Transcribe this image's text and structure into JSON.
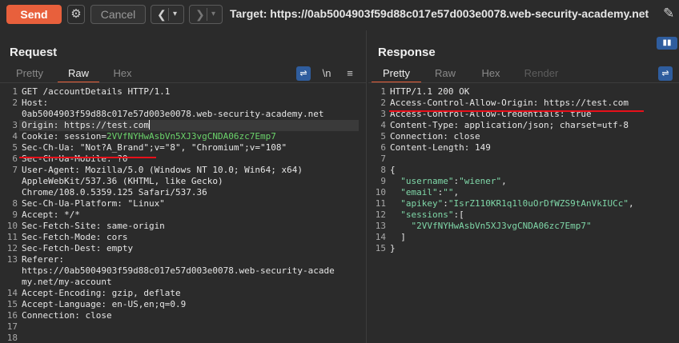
{
  "toolbar": {
    "send_label": "Send",
    "settings_icon": "gear-icon",
    "cancel_label": "Cancel",
    "back_icon": "chevron-left-icon",
    "forward_icon": "chevron-right-icon",
    "dropdown_icon": "caret-down-icon",
    "target_text": "Target: https://0ab5004903f59d88c017e57d003e0078.web-security-academy.net",
    "edit_icon": "pencil-icon"
  },
  "request": {
    "title": "Request",
    "tabs": [
      "Pretty",
      "Raw",
      "Hex"
    ],
    "active_tab": "Raw",
    "tools": {
      "wrap_icon": "wrap-lines-icon",
      "newline_label": "\\n",
      "menu_icon": "hamburger-icon"
    },
    "lines": [
      {
        "n": "1",
        "parts": [
          [
            "k",
            "GET /accountDetails HTTP/1.1"
          ]
        ]
      },
      {
        "n": "2",
        "parts": [
          [
            "k",
            "Host:"
          ]
        ]
      },
      {
        "n": "",
        "parts": [
          [
            "k",
            "0ab5004903f59d88c017e57d003e0078.web-security-academy.net"
          ]
        ]
      },
      {
        "n": "3",
        "parts": [
          [
            "k",
            "Origin: https://test.com"
          ]
        ],
        "highlight": true,
        "cursor": true
      },
      {
        "n": "4",
        "parts": [
          [
            "k",
            "Cookie: session="
          ],
          [
            "g",
            "2VVfNYHwAsbVn5XJ3vgCNDA06zc7Emp7"
          ]
        ]
      },
      {
        "n": "5",
        "parts": [
          [
            "k",
            "Sec-Ch-Ua: \"Not?A_Brand\";v=\"8\", \"Chromium\";v=\"108\""
          ]
        ]
      },
      {
        "n": "6",
        "parts": [
          [
            "k",
            "Sec-Ch-Ua-Mobile: ?0"
          ]
        ]
      },
      {
        "n": "7",
        "parts": [
          [
            "k",
            "User-Agent: Mozilla/5.0 (Windows NT 10.0; Win64; x64)"
          ]
        ]
      },
      {
        "n": "",
        "parts": [
          [
            "k",
            "AppleWebKit/537.36 (KHTML, like Gecko)"
          ]
        ]
      },
      {
        "n": "",
        "parts": [
          [
            "k",
            "Chrome/108.0.5359.125 Safari/537.36"
          ]
        ]
      },
      {
        "n": "8",
        "parts": [
          [
            "k",
            "Sec-Ch-Ua-Platform: \"Linux\""
          ]
        ]
      },
      {
        "n": "9",
        "parts": [
          [
            "k",
            "Accept: */*"
          ]
        ]
      },
      {
        "n": "10",
        "parts": [
          [
            "k",
            "Sec-Fetch-Site: same-origin"
          ]
        ]
      },
      {
        "n": "11",
        "parts": [
          [
            "k",
            "Sec-Fetch-Mode: cors"
          ]
        ]
      },
      {
        "n": "12",
        "parts": [
          [
            "k",
            "Sec-Fetch-Dest: empty"
          ]
        ]
      },
      {
        "n": "13",
        "parts": [
          [
            "k",
            "Referer:"
          ]
        ]
      },
      {
        "n": "",
        "parts": [
          [
            "k",
            "https://0ab5004903f59d88c017e57d003e0078.web-security-acade"
          ]
        ]
      },
      {
        "n": "",
        "parts": [
          [
            "k",
            "my.net/my-account"
          ]
        ]
      },
      {
        "n": "14",
        "parts": [
          [
            "k",
            "Accept-Encoding: gzip, deflate"
          ]
        ]
      },
      {
        "n": "15",
        "parts": [
          [
            "k",
            "Accept-Language: en-US,en;q=0.9"
          ]
        ]
      },
      {
        "n": "16",
        "parts": [
          [
            "k",
            "Connection: close"
          ]
        ]
      },
      {
        "n": "17",
        "parts": []
      },
      {
        "n": "18",
        "parts": []
      }
    ]
  },
  "response": {
    "title": "Response",
    "tabs": [
      "Pretty",
      "Raw",
      "Hex",
      "Render"
    ],
    "active_tab": "Pretty",
    "tools": {
      "wrap_icon": "wrap-lines-icon",
      "layout_icon": "split-layout-icon"
    },
    "lines": [
      {
        "n": "1",
        "parts": [
          [
            "k",
            "HTTP/1.1 200 OK"
          ]
        ]
      },
      {
        "n": "2",
        "parts": [
          [
            "k",
            "Access-Control-Allow-Origin: https://test.com"
          ]
        ]
      },
      {
        "n": "3",
        "parts": [
          [
            "k",
            "Access-Control-Allow-Credentials: true"
          ]
        ]
      },
      {
        "n": "4",
        "parts": [
          [
            "k",
            "Content-Type: application/json; charset=utf-8"
          ]
        ]
      },
      {
        "n": "5",
        "parts": [
          [
            "k",
            "Connection: close"
          ]
        ]
      },
      {
        "n": "6",
        "parts": [
          [
            "k",
            "Content-Length: 149"
          ]
        ]
      },
      {
        "n": "7",
        "parts": []
      },
      {
        "n": "8",
        "parts": [
          [
            "k",
            "{"
          ]
        ]
      },
      {
        "n": "9",
        "parts": [
          [
            "k",
            "  "
          ],
          [
            "j",
            "\"username\""
          ],
          [
            "k",
            ":"
          ],
          [
            "j",
            "\"wiener\""
          ],
          [
            "k",
            ","
          ]
        ]
      },
      {
        "n": "10",
        "parts": [
          [
            "k",
            "  "
          ],
          [
            "j",
            "\"email\""
          ],
          [
            "k",
            ":"
          ],
          [
            "j",
            "\"\""
          ],
          [
            "k",
            ","
          ]
        ]
      },
      {
        "n": "11",
        "parts": [
          [
            "k",
            "  "
          ],
          [
            "j",
            "\"apikey\""
          ],
          [
            "k",
            ":"
          ],
          [
            "j",
            "\"IsrZ110KR1q1l0uOrDfWZS9tAnVkIUCc\""
          ],
          [
            "k",
            ","
          ]
        ]
      },
      {
        "n": "12",
        "parts": [
          [
            "k",
            "  "
          ],
          [
            "j",
            "\"sessions\""
          ],
          [
            "k",
            ":["
          ]
        ]
      },
      {
        "n": "13",
        "parts": [
          [
            "k",
            "    "
          ],
          [
            "j",
            "\"2VVfNYHwAsbVn5XJ3vgCNDA06zc7Emp7\""
          ]
        ]
      },
      {
        "n": "14",
        "parts": [
          [
            "k",
            "  ]"
          ]
        ]
      },
      {
        "n": "15",
        "parts": [
          [
            "k",
            "}"
          ]
        ]
      }
    ]
  },
  "colors": {
    "accent": "#e8603c",
    "annotation": "#e8101a",
    "selection": "#2f5d9e"
  }
}
